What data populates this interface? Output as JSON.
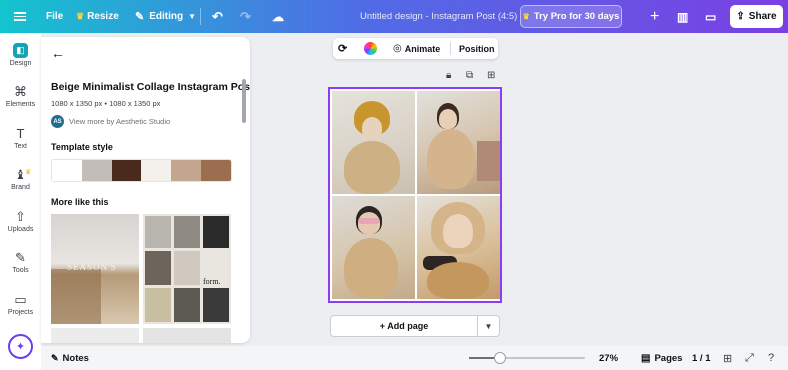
{
  "topbar": {
    "file_label": "File",
    "resize_label": "Resize",
    "editing_label": "Editing",
    "doc_title": "Untitled design - Instagram Post (4:5)",
    "try_pro_label": "Try Pro for 30 days",
    "share_label": "Share"
  },
  "rail": {
    "items": [
      {
        "label": "Design",
        "icon": "design-icon"
      },
      {
        "label": "Elements",
        "icon": "elements-icon"
      },
      {
        "label": "Text",
        "icon": "text-icon"
      },
      {
        "label": "Brand",
        "icon": "brand-icon"
      },
      {
        "label": "Uploads",
        "icon": "uploads-icon"
      },
      {
        "label": "Tools",
        "icon": "tools-icon"
      },
      {
        "label": "Projects",
        "icon": "projects-icon"
      }
    ]
  },
  "panel": {
    "template_title": "Beige Minimalist Collage Instagram Post",
    "template_size": "1080 x 1350 px • 1080 x 1350 px",
    "author_initials": "AS",
    "author_link": "View more by Aesthetic Studio",
    "style_heading": "Template style",
    "swatches": [
      "#ffffff",
      "#c2bdb8",
      "#4a2a1c",
      "#f4f1ec",
      "#c3a68d",
      "#9b6e4f"
    ],
    "more_heading": "More like this",
    "thumb1_text": "SEASON'S",
    "thumb2_text": "form."
  },
  "floatbar": {
    "animate_label": "Animate",
    "position_label": "Position"
  },
  "canvas": {
    "add_page_label": "+ Add page",
    "accent_color": "#8b3df5"
  },
  "bottombar": {
    "notes_label": "Notes",
    "zoom_level": "27%",
    "zoom_fraction": 0.27,
    "pages_label": "Pages",
    "page_number": "1 / 1"
  }
}
